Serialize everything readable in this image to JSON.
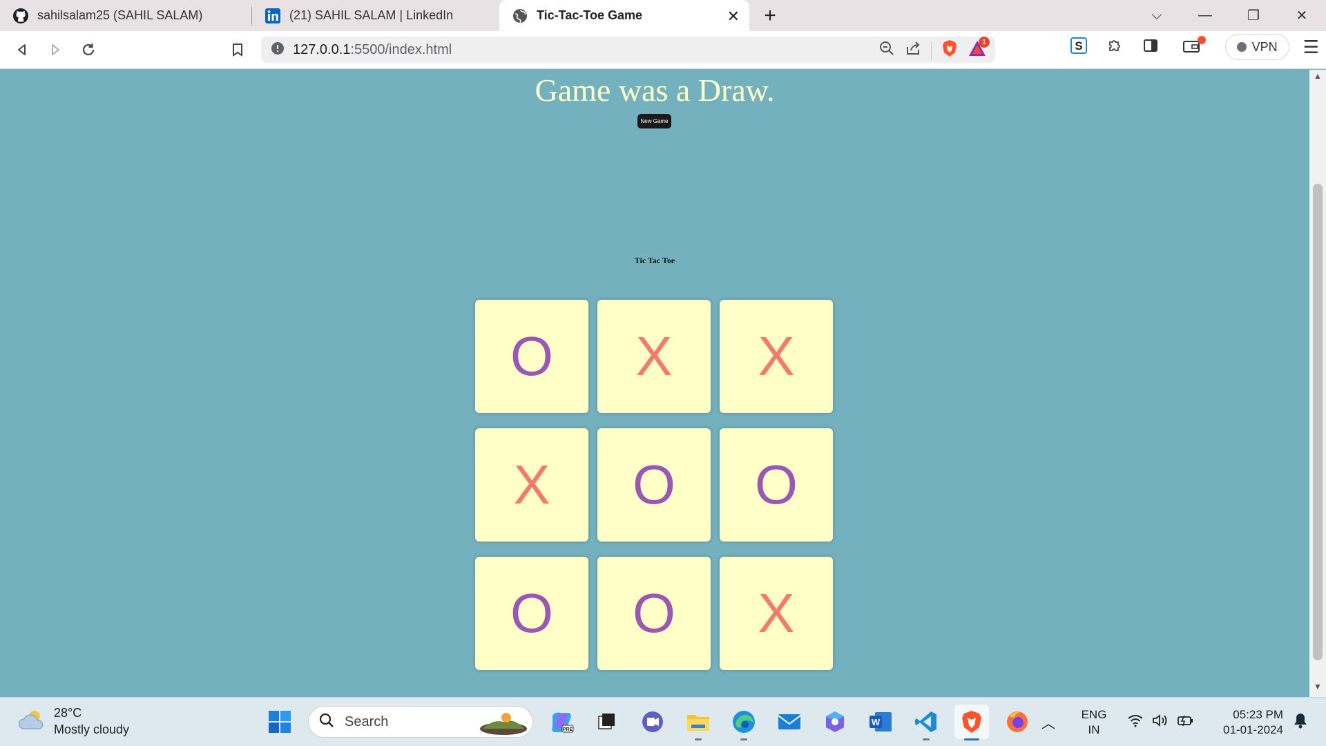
{
  "browser": {
    "tabs": [
      {
        "label": "sahilsalam25 (SAHIL SALAM)",
        "icon": "github-icon",
        "active": false
      },
      {
        "label": "(21) SAHIL SALAM | LinkedIn",
        "icon": "linkedin-icon",
        "active": false
      },
      {
        "label": "Tic-Tac-Toe Game",
        "icon": "globe-icon",
        "active": true
      }
    ],
    "url_host": "127.0.0.1",
    "url_rest": ":5500/index.html",
    "vpn_label": "VPN",
    "brave_badge": "1"
  },
  "page": {
    "message": "Game was a Draw.",
    "new_game_label": "New Game",
    "title": "Tic Tac Toe",
    "board": [
      [
        "O",
        "X",
        "X"
      ],
      [
        "X",
        "O",
        "O"
      ],
      [
        "O",
        "O",
        "X"
      ]
    ],
    "colors": {
      "background": "#74b1bf",
      "cell": "#ffffc7",
      "x": "#f37b6d",
      "o": "#9a57b3"
    }
  },
  "taskbar": {
    "temperature": "28°C",
    "weather": "Mostly cloudy",
    "search_placeholder": "Search",
    "lang_1": "ENG",
    "lang_2": "IN",
    "time": "05:23 PM",
    "date": "01-01-2024",
    "pinned": [
      "windows-start-icon",
      "search-icon",
      "copilot-icon",
      "task-view-icon",
      "teams-chat-icon",
      "file-explorer-icon",
      "edge-icon",
      "mail-icon",
      "copilot-app-icon",
      "word-icon",
      "vscode-icon",
      "brave-icon",
      "firefox-icon"
    ]
  }
}
